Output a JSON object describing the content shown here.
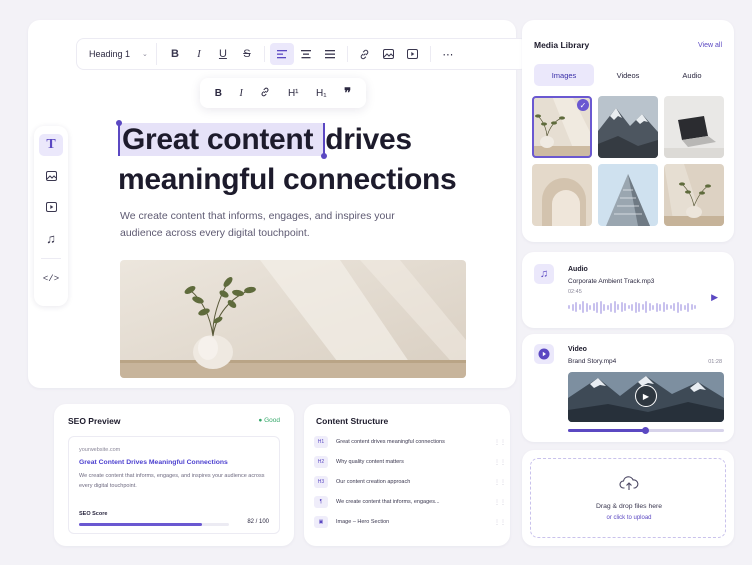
{
  "editor": {
    "toolbar": {
      "style_select": "Heading 1",
      "buttons": [
        {
          "name": "bold-button",
          "glyph": "B"
        },
        {
          "name": "italic-button",
          "glyph": "I"
        },
        {
          "name": "underline-button",
          "glyph": "U"
        },
        {
          "name": "strikethrough-button",
          "glyph": "S"
        },
        {
          "name": "align-left-button",
          "glyph": "≡"
        },
        {
          "name": "align-center-button",
          "glyph": "≡"
        },
        {
          "name": "align-right-button",
          "glyph": "≡"
        },
        {
          "name": "link-button",
          "glyph": "🔗"
        },
        {
          "name": "image-button",
          "glyph": "▣"
        },
        {
          "name": "video-button",
          "glyph": "▶"
        },
        {
          "name": "more-button",
          "glyph": "⋯"
        }
      ]
    },
    "floating_toolbar": [
      "B",
      "I",
      "🔗",
      "H¹",
      "H₁",
      "❞"
    ],
    "side_tools": [
      "text-tool",
      "image-tool",
      "video-tool",
      "audio-tool",
      "code-tool"
    ],
    "headline_selected": "Great content",
    "headline_rest": " drives",
    "headline_line2": "meaningful connections",
    "subtext": "We create content that informs, engages, and inspires your audience across every digital touchpoint."
  },
  "seo": {
    "title": "SEO Preview",
    "status": "● Good",
    "url": "yourwebsite.com",
    "link_title": "Great Content Drives Meaningful Connections",
    "description": "We create content that informs, engages, and inspires your audience across every digital touchpoint.",
    "score_label": "SEO Score",
    "score_text": "82 / 100",
    "score_value": 82
  },
  "structure": {
    "title": "Content Structure",
    "rows": [
      {
        "tag": "H1",
        "text": "Great content drives meaningful connections"
      },
      {
        "tag": "H2",
        "text": "Why quality content matters"
      },
      {
        "tag": "H3",
        "text": "Our content creation approach"
      },
      {
        "tag": "¶",
        "text": "We create content that informs, engages..."
      },
      {
        "tag": "▣",
        "text": "Image – Hero Section"
      }
    ]
  },
  "media": {
    "title": "Media Library",
    "view_all": "View all",
    "tabs": [
      "Images",
      "Videos",
      "Audio"
    ],
    "active_tab": "Images"
  },
  "audio": {
    "title": "Audio",
    "file": "Corporate Ambient Track.mp3",
    "time": "02:45"
  },
  "video": {
    "title": "Video",
    "file": "Brand Story.mp4",
    "time": "01:28",
    "progress": 0.5
  },
  "upload": {
    "text": "Drag & drop files here",
    "subtext": "or click to upload"
  },
  "colors": {
    "accent": "#5b48c2",
    "accent_light": "#ebe8fb",
    "good": "#35a86a",
    "background": "#f3f2f7"
  }
}
